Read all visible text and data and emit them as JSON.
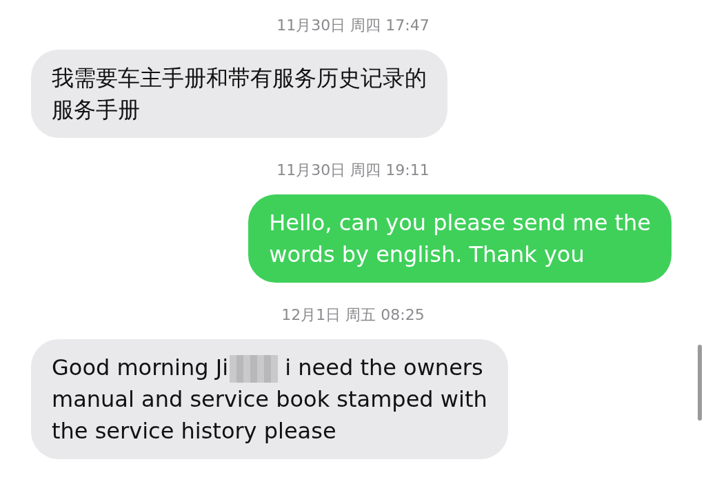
{
  "messages": [
    {
      "kind": "timestamp",
      "text": "11月30日 周四 17:47"
    },
    {
      "kind": "message",
      "sent": false,
      "lines": [
        {
          "text": "我需要车主手册和带有服务历史记录的"
        },
        {
          "text": "服务手册"
        }
      ]
    },
    {
      "kind": "timestamp",
      "text": "11月30日 周四 19:11"
    },
    {
      "kind": "message",
      "sent": true,
      "lines": [
        {
          "text": "Hello, can you please send me the"
        },
        {
          "text": "words by english. Thank you"
        }
      ]
    },
    {
      "kind": "timestamp",
      "text": "12月1日 周五 08:25"
    },
    {
      "kind": "message",
      "sent": false,
      "lines": [
        {
          "text": "Good morning Ji",
          "redacted": true,
          "text_after": " i need the owners"
        },
        {
          "text": "manual and service book stamped with"
        },
        {
          "text": "the service history please"
        }
      ]
    }
  ]
}
